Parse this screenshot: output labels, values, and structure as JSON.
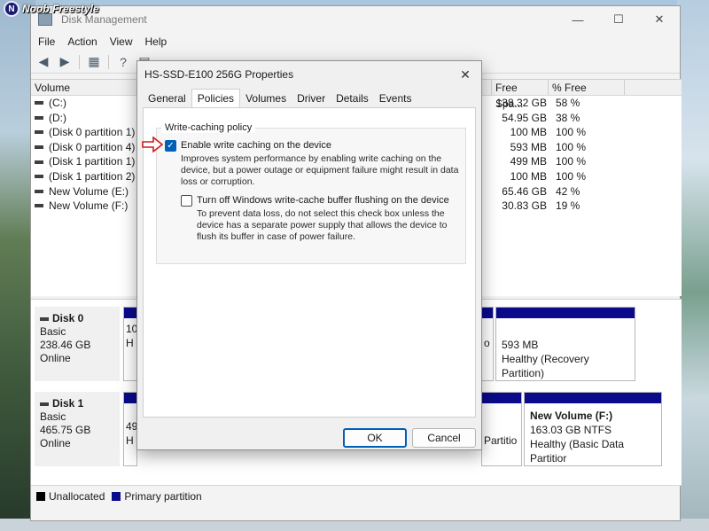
{
  "watermark": {
    "text": "Noob Freestyle",
    "logo": "N"
  },
  "window": {
    "title": "Disk Management",
    "controls": {
      "minimize": "—",
      "maximize": "☐",
      "close": "✕"
    }
  },
  "menu": [
    "File",
    "Action",
    "View",
    "Help"
  ],
  "list": {
    "headers": {
      "volume": "Volume",
      "free": "Free Spa...",
      "pct": "% Free"
    },
    "rows": [
      {
        "volume": "(C:)",
        "free": "138.32 GB",
        "pct": "58 %"
      },
      {
        "volume": "(D:)",
        "free": "54.95 GB",
        "pct": "38 %"
      },
      {
        "volume": "(Disk 0 partition 1)",
        "free": "100 MB",
        "pct": "100 %"
      },
      {
        "volume": "(Disk 0 partition 4)",
        "free": "593 MB",
        "pct": "100 %"
      },
      {
        "volume": "(Disk 1 partition 1)",
        "free": "499 MB",
        "pct": "100 %"
      },
      {
        "volume": "(Disk 1 partition 2)",
        "free": "100 MB",
        "pct": "100 %"
      },
      {
        "volume": "New Volume (E:)",
        "free": "65.46 GB",
        "pct": "42 %"
      },
      {
        "volume": "New Volume (F:)",
        "free": "30.83 GB",
        "pct": "19 %"
      }
    ]
  },
  "disks": [
    {
      "name": "Disk 0",
      "type": "Basic",
      "size": "238.46 GB",
      "status": "Online",
      "left_part": {
        "line1": "10",
        "line2": "H"
      },
      "mid_part_tail": "o",
      "right_part": {
        "line1": "593 MB",
        "line2": "Healthy (Recovery Partition)"
      }
    },
    {
      "name": "Disk 1",
      "type": "Basic",
      "size": "465.75 GB",
      "status": "Online",
      "left_part": {
        "line1": "49",
        "line2": "H"
      },
      "mid_part_tail": "Partitio",
      "right_part": {
        "title": "New Volume  (F:)",
        "line1": "163.03 GB NTFS",
        "line2": "Healthy (Basic Data Partitior"
      }
    }
  ],
  "legend": [
    {
      "label": "Unallocated",
      "color": "#000000"
    },
    {
      "label": "Primary partition",
      "color": "#0a0a8a"
    }
  ],
  "dialog": {
    "title": "HS-SSD-E100 256G Properties",
    "close": "✕",
    "tabs": [
      "General",
      "Policies",
      "Volumes",
      "Driver",
      "Details",
      "Events"
    ],
    "active_tab": "Policies",
    "group_label": "Write-caching policy",
    "option1": {
      "label": "Enable write caching on the device",
      "checked": true,
      "desc1": "Improves system performance by enabling write caching on the",
      "desc2": "device, but a power outage or equipment failure might result in data",
      "desc3": "loss or corruption."
    },
    "option2": {
      "label": "Turn off Windows write-cache buffer flushing on the device",
      "checked": false,
      "desc1": "To prevent data loss, do not select this check box unless the",
      "desc2": "device has a separate power supply that allows the device to",
      "desc3": "flush its buffer in case of power failure."
    },
    "ok": "OK",
    "cancel": "Cancel"
  }
}
